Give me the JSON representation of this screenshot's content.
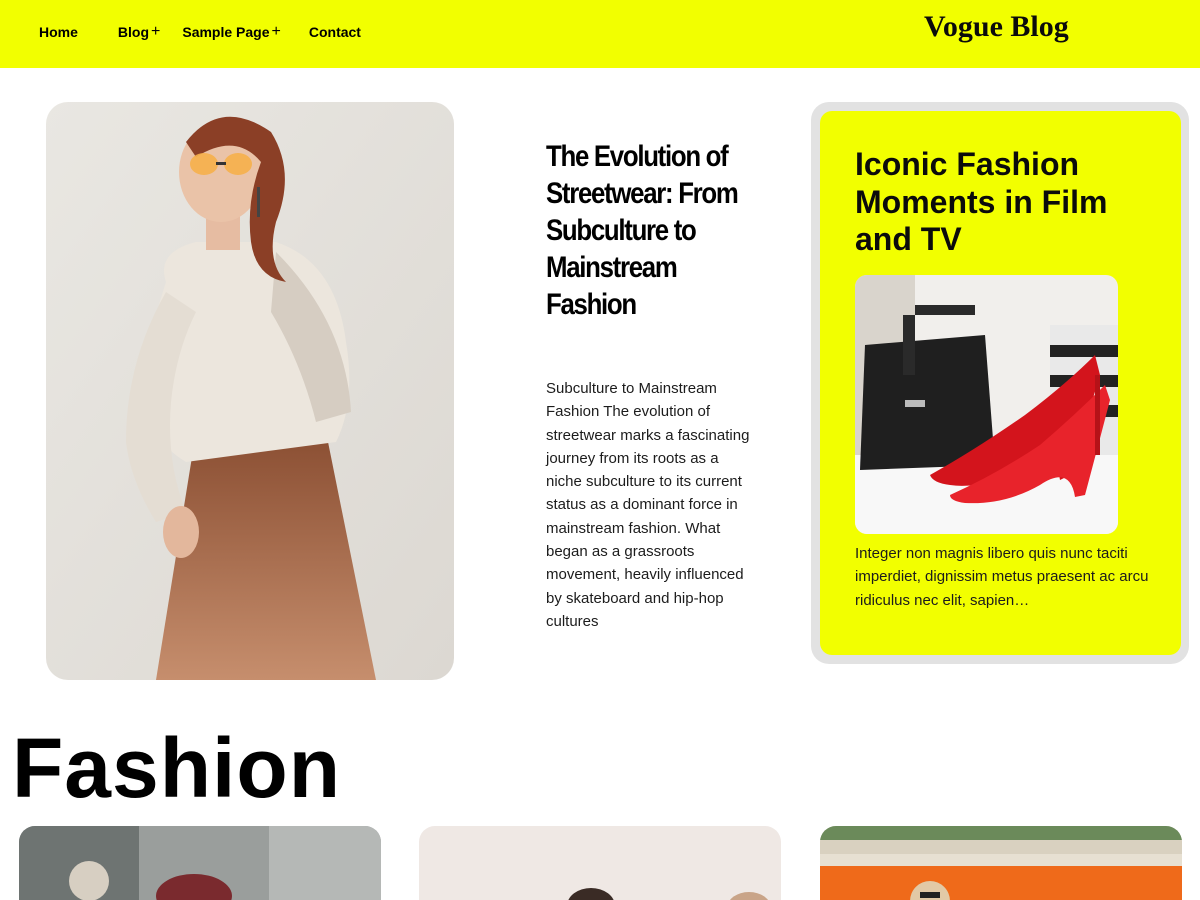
{
  "header": {
    "brand": "Vogue Blog",
    "nav": [
      {
        "label": "Home",
        "has_submenu": false
      },
      {
        "label": "Blog",
        "has_submenu": true
      },
      {
        "label": "Sample Page",
        "has_submenu": true
      },
      {
        "label": "Contact",
        "has_submenu": false
      }
    ],
    "submenu_icon": "+",
    "background_color": "#f2ff00"
  },
  "featured": {
    "title": "The Evolution of Streetwear: From Subculture to Mainstream Fashion",
    "excerpt": "Subculture to Mainstream Fashion The evolution of streetwear marks a fascinating journey from its roots as a niche subculture to its current status as a dominant force in mainstream fashion. What began as a grassroots movement, heavily influenced by skateboard and hip-hop cultures"
  },
  "side_card": {
    "title": "Iconic Fashion Moments in Film and TV",
    "excerpt": "Integer non magnis libero quis nunc taciti imperdiet, dignissim metus praesent ac arcu ridiculus nec elit, sapien…",
    "accent_color": "#f2ff00"
  },
  "section": {
    "heading": "Fashion"
  }
}
